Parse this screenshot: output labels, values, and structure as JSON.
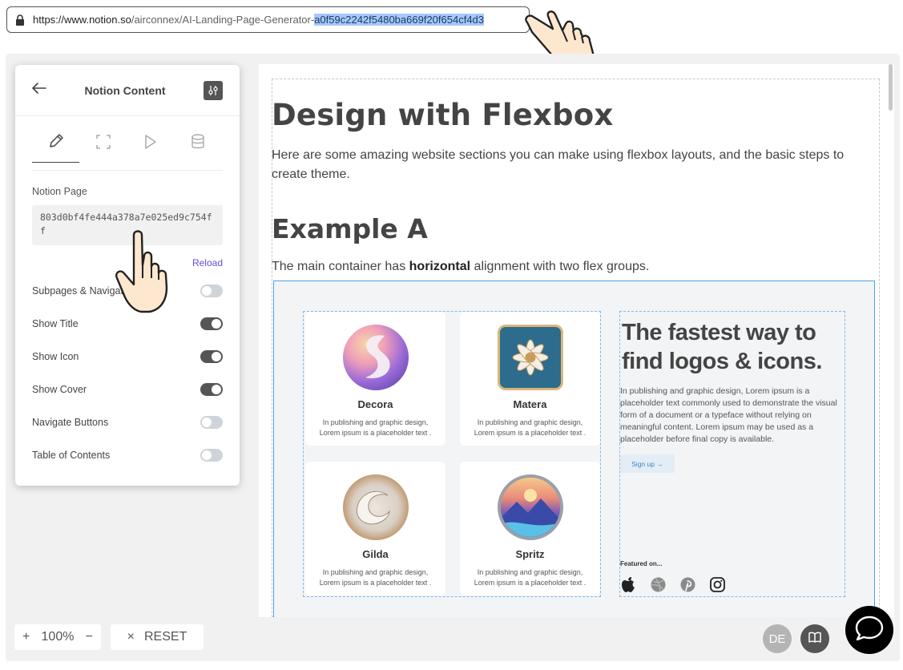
{
  "browser": {
    "url_base": "https://www.notion.so",
    "url_path": "/airconnex/AI-Landing-Page-Generator-",
    "url_selected": "a0f59c2242f5480ba669f20f654cf4d3"
  },
  "panel": {
    "title": "Notion Content",
    "tabs": [
      "pencil-icon",
      "expand-icon",
      "play-icon",
      "database-icon"
    ],
    "notion_page_label": "Notion Page",
    "notion_page_value": "803d0bf4fe444a378a7e025ed9c754ff",
    "reload_label": "Reload",
    "toggles": [
      {
        "label": "Subpages & Navigation",
        "on": false
      },
      {
        "label": "Show Title",
        "on": true
      },
      {
        "label": "Show Icon",
        "on": true
      },
      {
        "label": "Show Cover",
        "on": true
      },
      {
        "label": "Navigate Buttons",
        "on": false
      },
      {
        "label": "Table of Contents",
        "on": false
      }
    ]
  },
  "page": {
    "title": "Design with Flexbox",
    "intro": "Here are some amazing website sections you can make using flexbox layouts, and the basic steps to create theme.",
    "example_heading": "Example A",
    "desc_before": "The main container has ",
    "desc_bold": "horizontal",
    "desc_after": " alignment with two flex groups.",
    "cards": [
      {
        "name": "Decora",
        "text": "In publishing and graphic design, Lorem ipsum is a placeholder text ."
      },
      {
        "name": "Matera",
        "text": "In publishing and graphic design, Lorem ipsum is a placeholder text ."
      },
      {
        "name": "Gilda",
        "text": "In publishing and graphic design, Lorem ipsum is a placeholder text ."
      },
      {
        "name": "Spritz",
        "text": "In publishing and graphic design, Lorem ipsum is a placeholder text ."
      }
    ],
    "hero_title": "The fastest way to find logos & icons.",
    "hero_text": "In publishing and graphic design, Lorem ipsum is a placeholder text commonly used to demonstrate the visual form of a document or a typeface without relying on meaningful content. Lorem ipsum may be used as a placeholder before final copy is available.",
    "signup_label": "Sign up →",
    "featured_label": "Featured on...",
    "social_icons": [
      "apple-icon",
      "dribbble-icon",
      "pinterest-icon",
      "instagram-icon"
    ]
  },
  "controls": {
    "zoom_plus": "+",
    "zoom_value": "100%",
    "zoom_minus": "−",
    "reset_icon": "×",
    "reset_label": "RESET",
    "avatar_initials": "DE"
  }
}
